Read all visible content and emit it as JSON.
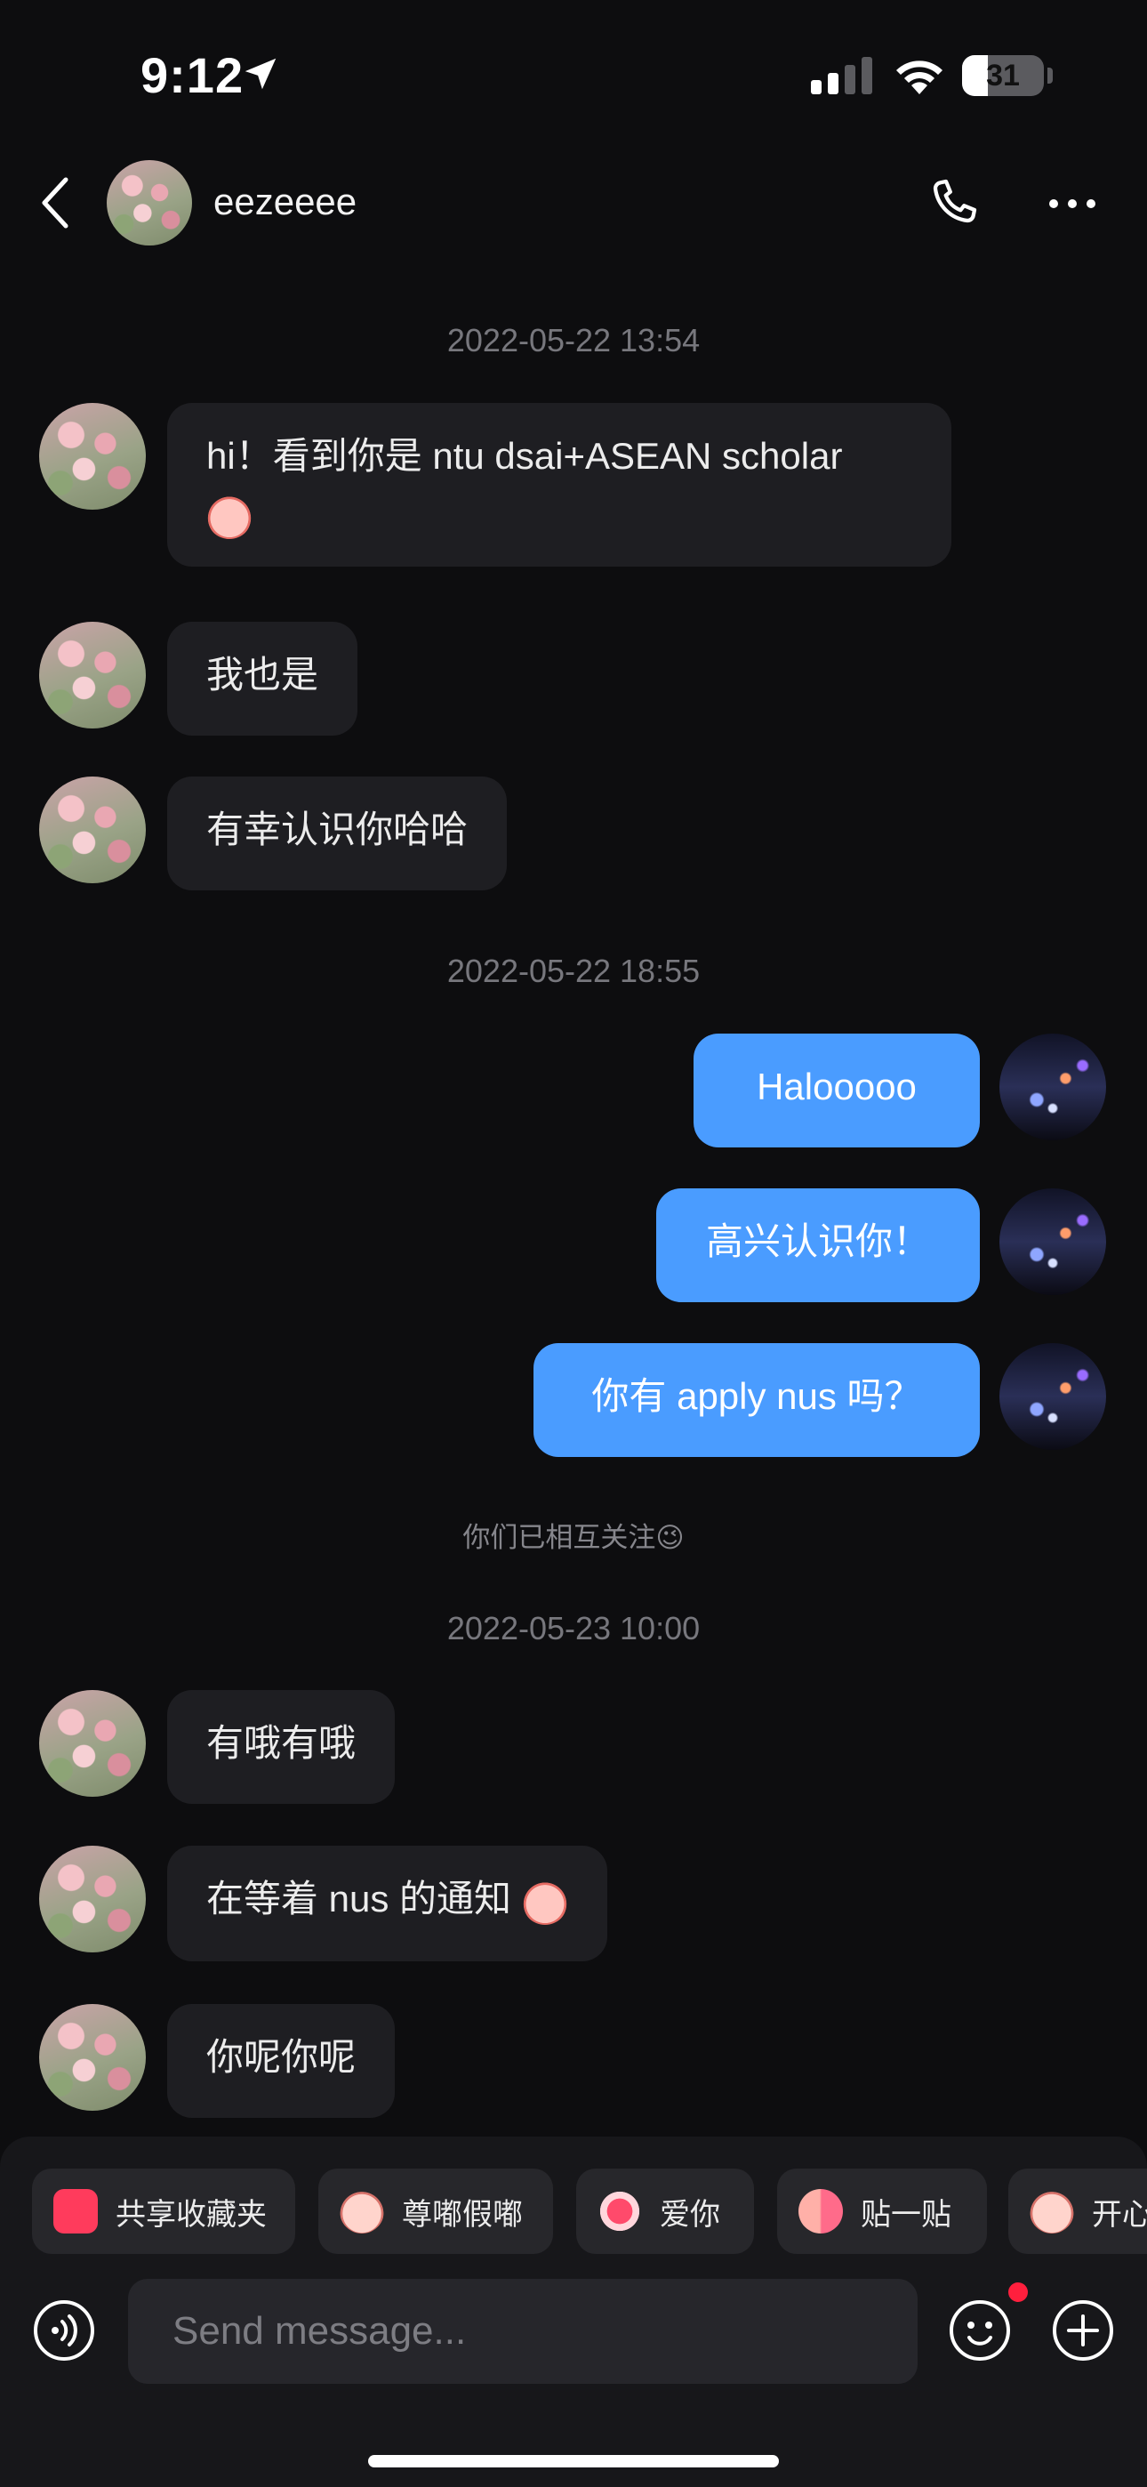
{
  "status_bar": {
    "time": "9:12",
    "battery": "31"
  },
  "header": {
    "contact_name": "eezeeee"
  },
  "messages": [
    {
      "type": "timestamp",
      "text": "2022-05-22 13:54"
    },
    {
      "type": "incoming",
      "text": "hi！看到你是 ntu dsai+ASEAN scholar"
    },
    {
      "type": "incoming",
      "text": "我也是"
    },
    {
      "type": "incoming",
      "text": "有幸认识你哈哈"
    },
    {
      "type": "timestamp",
      "text": "2022-05-22 18:55"
    },
    {
      "type": "outgoing",
      "text": "Halooooo"
    },
    {
      "type": "outgoing",
      "text": "高兴认识你！"
    },
    {
      "type": "outgoing",
      "text": "你有 apply nus 吗？"
    },
    {
      "type": "system",
      "text": "你们已相互关注😉"
    },
    {
      "type": "timestamp",
      "text": "2022-05-23 10:00"
    },
    {
      "type": "incoming",
      "text": "有哦有哦"
    },
    {
      "type": "incoming",
      "text": "在等着 nus 的通知"
    },
    {
      "type": "incoming",
      "text": "你呢你呢"
    }
  ],
  "quick_replies": [
    {
      "label": "共享收藏夹",
      "icon": "folder-star-icon"
    },
    {
      "label": "尊嘟假嘟",
      "icon": "pig-face-icon"
    },
    {
      "label": "爱你",
      "icon": "heart-pig-icon"
    },
    {
      "label": "贴一贴",
      "icon": "cheek-kiss-icon"
    },
    {
      "label": "开心",
      "icon": "happy-sticker-icon"
    }
  ],
  "composer": {
    "placeholder": "Send message..."
  },
  "colors": {
    "background": "#0d0d0f",
    "incoming_bubble": "#1e1e22",
    "outgoing_bubble": "#4a9cff",
    "badge": "#ff1f3d"
  }
}
